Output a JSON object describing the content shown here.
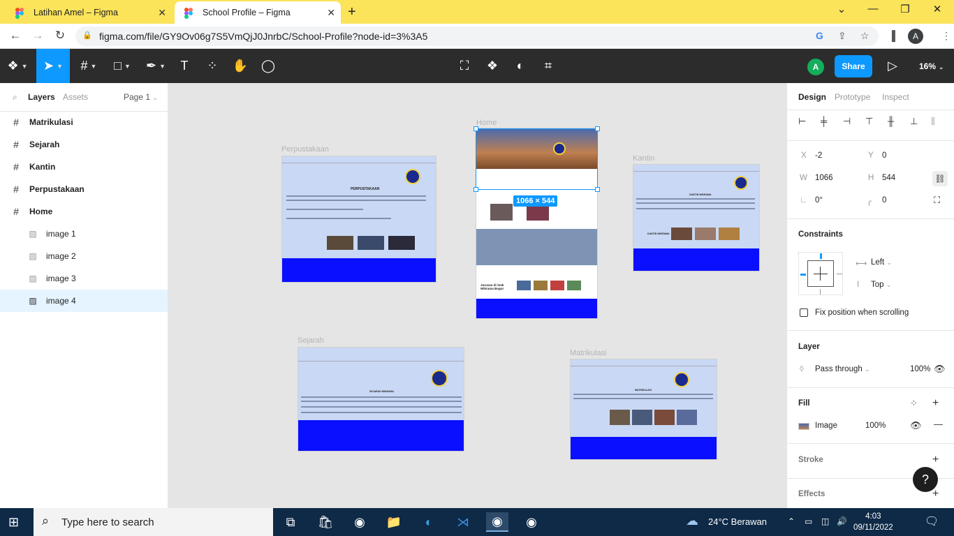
{
  "browser": {
    "tabs": [
      {
        "title": "Latihan Amel – Figma",
        "active": false
      },
      {
        "title": "School Profile – Figma",
        "active": true
      }
    ],
    "url": "figma.com/file/GY9Ov06g7S5VmQjJ0JnrbC/School-Profile?node-id=3%3A5",
    "profile_initial": "A"
  },
  "toolbar": {
    "avatar_initial": "A",
    "share_label": "Share",
    "zoom": "16%"
  },
  "left_panel": {
    "tabs": {
      "layers": "Layers",
      "assets": "Assets",
      "page": "Page 1"
    },
    "layers": [
      {
        "name": "Matrikulasi",
        "type": "frame",
        "child": false,
        "selected": false
      },
      {
        "name": "Sejarah",
        "type": "frame",
        "child": false,
        "selected": false
      },
      {
        "name": "Kantin",
        "type": "frame",
        "child": false,
        "selected": false
      },
      {
        "name": "Perpustakaan",
        "type": "frame",
        "child": false,
        "selected": false
      },
      {
        "name": "Home",
        "type": "frame",
        "child": false,
        "selected": false
      },
      {
        "name": "image 1",
        "type": "image",
        "child": true,
        "selected": false
      },
      {
        "name": "image 2",
        "type": "image",
        "child": true,
        "selected": false
      },
      {
        "name": "image 3",
        "type": "image",
        "child": true,
        "selected": false
      },
      {
        "name": "image 4",
        "type": "image",
        "child": true,
        "selected": true
      }
    ]
  },
  "canvas": {
    "frames": {
      "perpustakaan": "Perpustakaan",
      "home": "Home",
      "kantin": "Kantin",
      "sejarah": "Sejarah",
      "matrikulasi": "Matrikulasi"
    },
    "selection_size": "1066 × 544",
    "home_section_title": "Jurusan di Smk Wikrama Bogor",
    "perpustakaan_heading": "PERPUSTAKAAN",
    "kantin_heading": "KANTIN WIKRAMA",
    "sejarah_heading": "SEJARAH WIKRAMA",
    "matrikulasi_heading": "MATRIKULASI"
  },
  "right_panel": {
    "tabs": {
      "design": "Design",
      "prototype": "Prototype",
      "inspect": "Inspect"
    },
    "x": "-2",
    "y": "0",
    "w": "1066",
    "h": "544",
    "rotation": "0°",
    "radius": "0",
    "constraints_title": "Constraints",
    "constraint_h": "Left",
    "constraint_v": "Top",
    "fix_position": "Fix position when scrolling",
    "layer_title": "Layer",
    "blend_mode": "Pass through",
    "layer_opacity": "100%",
    "fill_title": "Fill",
    "fill_type": "Image",
    "fill_opacity": "100%",
    "stroke_title": "Stroke",
    "effects_title": "Effects",
    "help": "?"
  },
  "taskbar": {
    "search_placeholder": "Type here to search",
    "weather": "24°C  Berawan",
    "time": "4:03",
    "date": "09/11/2022"
  }
}
